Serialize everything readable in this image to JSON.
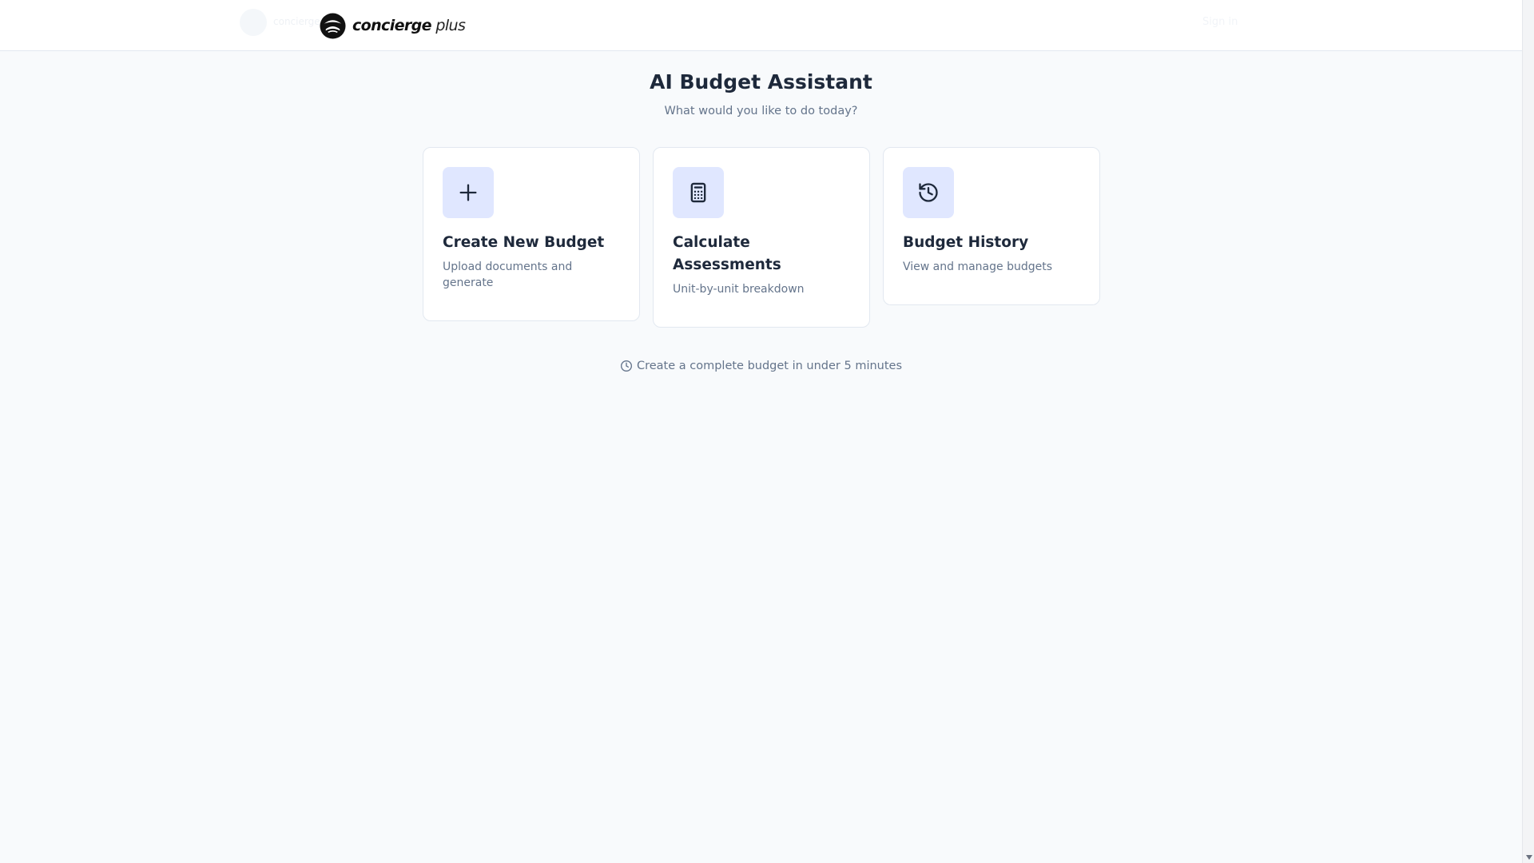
{
  "header": {
    "brand_name": "concierge",
    "brand_suffix": "plus",
    "ghost_left_text": "concierge",
    "ghost_right_text": "Sign in"
  },
  "main": {
    "title": "AI Budget Assistant",
    "subtitle": "What would you like to do today?",
    "cards": [
      {
        "icon": "plus-icon",
        "title": "Create New Budget",
        "description": "Upload documents and generate"
      },
      {
        "icon": "calculator-icon",
        "title": "Calculate Assessments",
        "description": "Unit-by-unit breakdown"
      },
      {
        "icon": "history-icon",
        "title": "Budget History",
        "description": "View and manage budgets"
      }
    ],
    "footnote": "Create a complete budget in under 5 minutes"
  },
  "colors": {
    "icon_bg": "#e0e7ff",
    "icon_stroke": "#1e293b",
    "page_bg": "#f8fafc",
    "muted_text": "#64748b"
  }
}
